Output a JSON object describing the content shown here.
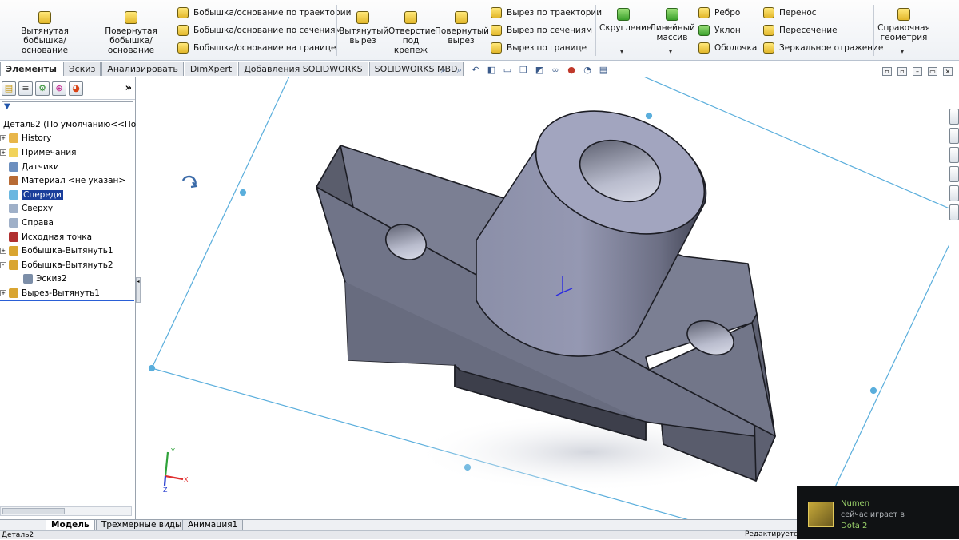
{
  "ribbon": {
    "features": {
      "extruded_boss": "Вытянутая бобышка/основание",
      "revolved_boss": "Повернутая бобышка/основание",
      "swept_boss": "Бобышка/основание по траектории",
      "lofted_boss": "Бобышка/основание по сечениям",
      "boundary_boss": "Бобышка/основание на границе",
      "extruded_cut": "Вытянутый вырез",
      "hole_wizard": "Отверстие под крепеж",
      "revolved_cut": "Повернутый вырез",
      "swept_cut": "Вырез по траектории",
      "lofted_cut": "Вырез по сечениям",
      "boundary_cut": "Вырез по границе",
      "fillet": "Скругление",
      "linear_pattern": "Линейный массив",
      "rib": "Ребро",
      "draft": "Уклон",
      "shell": "Оболочка",
      "wrap": "Перенос",
      "intersect": "Пересечение",
      "mirror": "Зеркальное отражение",
      "ref_geometry": "Справочная геометрия"
    }
  },
  "tabs": [
    "Элементы",
    "Эскиз",
    "Анализировать",
    "DimXpert",
    "Добавления SOLIDWORKS",
    "SOLIDWORKS MBD"
  ],
  "tree": {
    "root": "Деталь2  (По умолчанию<<По умо",
    "items": [
      {
        "label": "History",
        "exp": "+"
      },
      {
        "label": "Примечания",
        "exp": "+"
      },
      {
        "label": "Датчики",
        "exp": ""
      },
      {
        "label": "Материал <не указан>",
        "exp": ""
      },
      {
        "label": "Спереди",
        "exp": "",
        "selected": true
      },
      {
        "label": "Сверху",
        "exp": ""
      },
      {
        "label": "Справа",
        "exp": ""
      },
      {
        "label": "Исходная точка",
        "exp": ""
      },
      {
        "label": "Бобышка-Вытянуть1",
        "exp": "+"
      },
      {
        "label": "Бобышка-Вытянуть2",
        "exp": "-"
      },
      {
        "label": "Эскиз2",
        "exp": "",
        "indent": true
      },
      {
        "label": "Вырез-Вытянуть1",
        "exp": "+"
      }
    ]
  },
  "bottom_tabs": [
    "Модель",
    "Трехмерные виды",
    "Анимация1"
  ],
  "status": {
    "left": "Деталь2",
    "right": "Редактируетс"
  },
  "axes": {
    "x": "X",
    "y": "Y",
    "z": "Z"
  },
  "notification": {
    "name": "Numen",
    "status": "сейчас играет в",
    "game": "Dota 2"
  },
  "colors": {
    "selection": "#1a3e9b",
    "plane": "#5aaedc",
    "model": "#7b7f93"
  }
}
